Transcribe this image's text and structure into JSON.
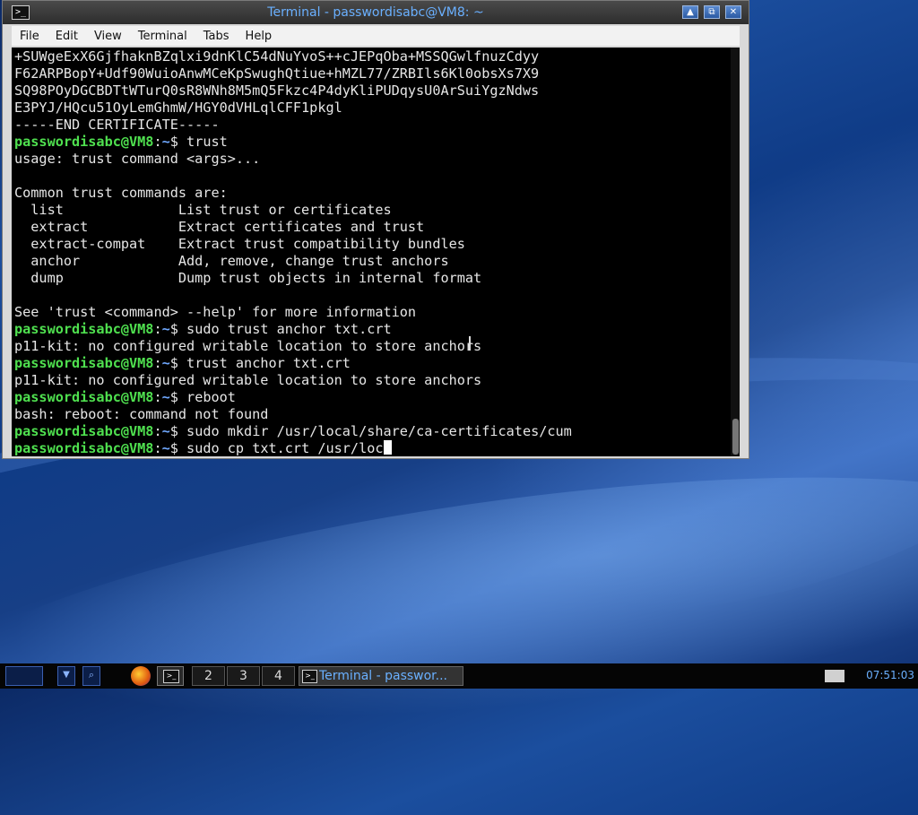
{
  "window": {
    "title": "Terminal - passwordisabc@VM8: ~",
    "buttons": [
      "▲",
      "⧉",
      "✕"
    ]
  },
  "menu": [
    "File",
    "Edit",
    "View",
    "Terminal",
    "Tabs",
    "Help"
  ],
  "terminal": {
    "lines": [
      {
        "type": "text",
        "text": "+SUWgeExX6GjfhaknBZqlxi9dnKlC54dNuYvoS++cJEPqOba+MSSQGwlfnuzCdyy"
      },
      {
        "type": "text",
        "text": "F62ARPBopY+Udf90WuioAnwMCeKpSwughQtiue+hMZL77/ZRBIls6Kl0obsXs7X9"
      },
      {
        "type": "text",
        "text": "SQ98POyDGCBDTtWTurQ0sR8WNh8M5mQ5Fkzc4P4dyKliPUDqysU0ArSuiYgzNdws"
      },
      {
        "type": "text",
        "text": "E3PYJ/HQcu51OyLemGhmW/HGY0dVHLqlCFF1pkgl"
      },
      {
        "type": "text",
        "text": "-----END CERTIFICATE-----"
      },
      {
        "type": "prompt",
        "user": "passwordisabc@VM8",
        "sep": ":",
        "path": "~",
        "cmd": "$ trust"
      },
      {
        "type": "text",
        "text": "usage: trust command <args>..."
      },
      {
        "type": "text",
        "text": ""
      },
      {
        "type": "text",
        "text": "Common trust commands are:"
      },
      {
        "type": "text",
        "text": "  list              List trust or certificates"
      },
      {
        "type": "text",
        "text": "  extract           Extract certificates and trust"
      },
      {
        "type": "text",
        "text": "  extract-compat    Extract trust compatibility bundles"
      },
      {
        "type": "text",
        "text": "  anchor            Add, remove, change trust anchors"
      },
      {
        "type": "text",
        "text": "  dump              Dump trust objects in internal format"
      },
      {
        "type": "text",
        "text": ""
      },
      {
        "type": "text",
        "text": "See 'trust <command> --help' for more information"
      },
      {
        "type": "prompt",
        "user": "passwordisabc@VM8",
        "sep": ":",
        "path": "~",
        "cmd": "$ sudo trust anchor txt.crt"
      },
      {
        "type": "text",
        "text": "p11-kit: no configured writable location to store anchors"
      },
      {
        "type": "prompt",
        "user": "passwordisabc@VM8",
        "sep": ":",
        "path": "~",
        "cmd": "$ trust anchor txt.crt"
      },
      {
        "type": "text",
        "text": "p11-kit: no configured writable location to store anchors"
      },
      {
        "type": "prompt",
        "user": "passwordisabc@VM8",
        "sep": ":",
        "path": "~",
        "cmd": "$ reboot"
      },
      {
        "type": "text",
        "text": "bash: reboot: command not found"
      },
      {
        "type": "prompt",
        "user": "passwordisabc@VM8",
        "sep": ":",
        "path": "~",
        "cmd": "$ sudo mkdir /usr/local/share/ca-certificates/cum"
      },
      {
        "type": "prompt",
        "user": "passwordisabc@VM8",
        "sep": ":",
        "path": "~",
        "cmd": "$ sudo cp txt.crt /usr/loc",
        "cursor": true
      }
    ]
  },
  "taskbar": {
    "workspaces": [
      "2",
      "3",
      "4"
    ],
    "task_label": "Terminal - passwor...",
    "clock": "07:51:03"
  }
}
